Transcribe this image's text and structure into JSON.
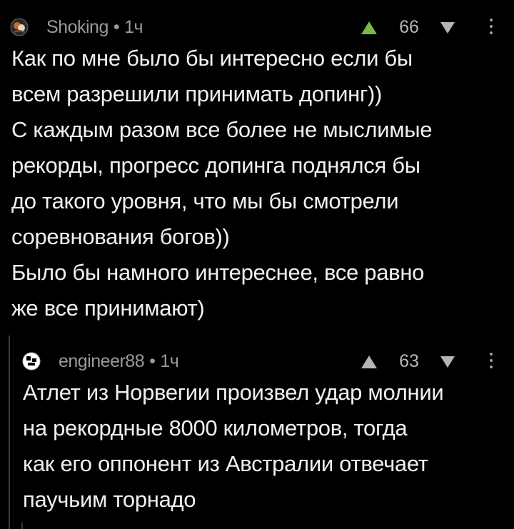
{
  "comments": [
    {
      "author": "Shoking",
      "separator": "•",
      "time": "1ч",
      "score": "66",
      "lines": [
        "Как по мне было бы интересно если бы",
        "всем разрешили принимать допинг))",
        "С каждым разом все более не мыслимые",
        "рекорды, прогресс допинга поднялся бы",
        "до такого уровня, что мы бы смотрели",
        "соревнования богов))",
        "Было бы намного интереснее, все равно",
        "же все принимают)"
      ]
    },
    {
      "author": "engineer88",
      "separator": "•",
      "time": "1ч",
      "score": "63",
      "lines": [
        "Атлет из Норвегии произвел удар молнии",
        "на рекордные 8000 километров, тогда",
        "как его оппонент из Австралии отвечает",
        "паучьим торнадо"
      ]
    }
  ],
  "icons": {
    "avatar_1": "avatar-icon",
    "avatar_2": "avatar-icon",
    "upvote": "triangle-up-icon",
    "downvote": "triangle-down-icon",
    "menu": "more-vertical-icon"
  },
  "colors": {
    "background": "#000000",
    "text": "#f0f0f0",
    "meta": "#9a9a9a",
    "upvote_active": "#7bb844",
    "vote_inactive": "#b5b5b5",
    "thread_line": "#3a3a3a"
  }
}
